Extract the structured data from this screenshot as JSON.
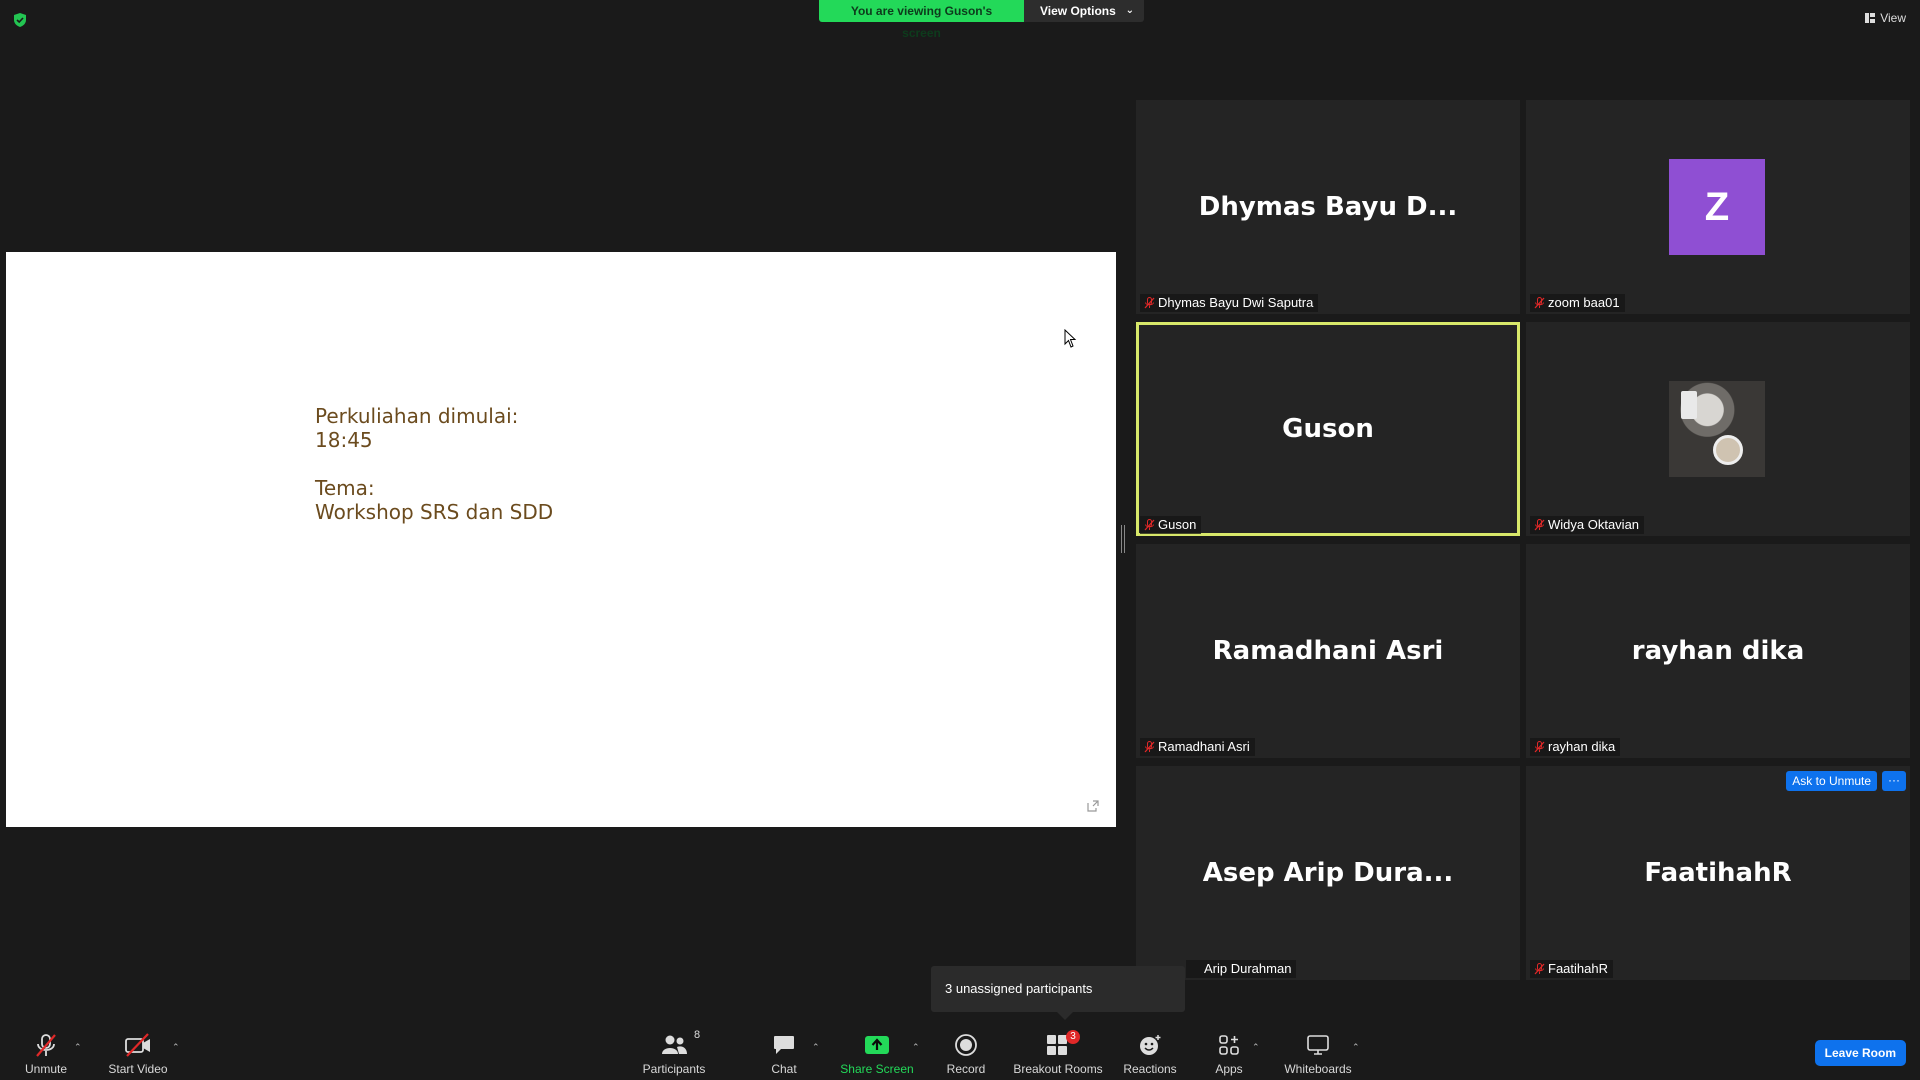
{
  "banner": {
    "viewing_text": "You are viewing Guson's screen",
    "view_options_label": "View Options"
  },
  "top_right": {
    "view_label": "View"
  },
  "shared_slide": {
    "line1": "Perkuliahan dimulai:",
    "line2": "18:45",
    "line3": "Tema:",
    "line4": "Workshop SRS dan SDD",
    "text_color": "#6b4b1e"
  },
  "participants_grid": [
    {
      "display": "Dhymas Bayu D...",
      "label": "Dhymas Bayu Dwi Saputra",
      "muted": true
    },
    {
      "display": "Z",
      "label": "zoom baa01",
      "muted": true,
      "avatar_color": "#8f4fd3"
    },
    {
      "display": "Guson",
      "label": "Guson",
      "muted": true,
      "active_speaker": true
    },
    {
      "display": "",
      "label": "Widya Oktavian",
      "muted": true,
      "has_photo": true
    },
    {
      "display": "Ramadhani Asri",
      "label": "Ramadhani Asri",
      "muted": true
    },
    {
      "display": "rayhan dika",
      "label": "rayhan dika",
      "muted": true
    },
    {
      "display": "Asep Arip Dura...",
      "label": "Arip Durahman",
      "muted": true
    },
    {
      "display": "FaatihahR",
      "label": "FaatihahR",
      "muted": true
    }
  ],
  "tile_actions": {
    "ask_to_unmute": "Ask to Unmute",
    "more": "···"
  },
  "popup": {
    "text": "3 unassigned participants"
  },
  "toolbar": {
    "unmute": "Unmute",
    "start_video": "Start Video",
    "participants": "Participants",
    "participants_count": "8",
    "chat": "Chat",
    "share_screen": "Share Screen",
    "record": "Record",
    "breakout_rooms": "Breakout Rooms",
    "breakout_badge": "3",
    "reactions": "Reactions",
    "apps": "Apps",
    "whiteboards": "Whiteboards",
    "leave_room": "Leave Room"
  },
  "colors": {
    "background": "#1a1a1a",
    "tile": "#242424",
    "share_green": "#23d959",
    "blue": "#0e72ed",
    "active_speaker_outline": "#d8e86a",
    "mute_red": "#e02828"
  }
}
